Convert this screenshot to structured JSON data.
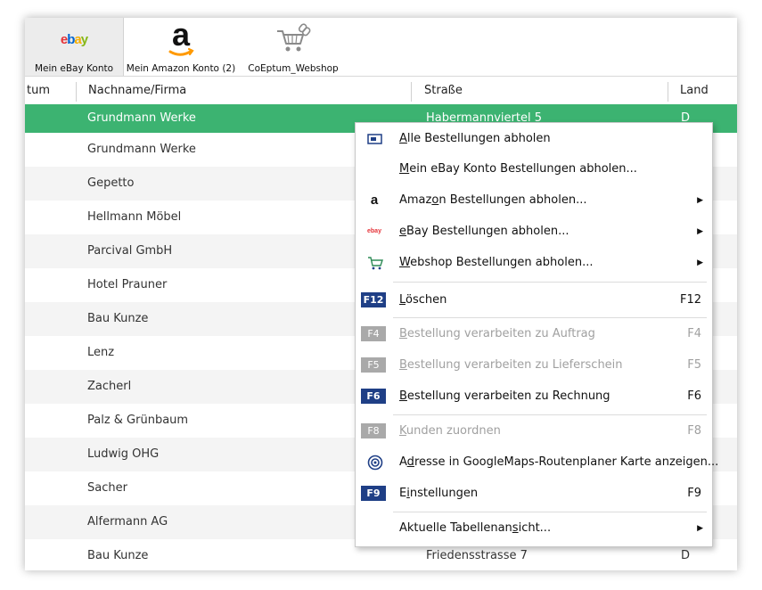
{
  "toolbar": {
    "buttons": [
      {
        "label": "Mein eBay Konto",
        "icon": "ebay-logo-icon"
      },
      {
        "label": "Mein Amazon Konto (2)",
        "icon": "amazon-logo-icon"
      },
      {
        "label": "CoEptum_Webshop",
        "icon": "webshop-cart-icon"
      }
    ]
  },
  "ebay_logo_text": [
    "e",
    "b",
    "a",
    "y"
  ],
  "amazon_logo_text": "a",
  "table": {
    "columns": [
      "tum",
      "Nachname/Firma",
      "Straße",
      "Land"
    ],
    "rows": [
      {
        "name": "Grundmann Werke",
        "street": "Habermannviertel 5",
        "country": "D"
      },
      {
        "name": "Grundmann Werke",
        "street": "",
        "country": ""
      },
      {
        "name": "Gepetto",
        "street": "",
        "country": ""
      },
      {
        "name": "Hellmann Möbel",
        "street": "",
        "country": ""
      },
      {
        "name": "Parcival GmbH",
        "street": "",
        "country": ""
      },
      {
        "name": "Hotel Prauner",
        "street": "",
        "country": ""
      },
      {
        "name": "Bau Kunze",
        "street": "",
        "country": ""
      },
      {
        "name": "Lenz",
        "street": "",
        "country": ""
      },
      {
        "name": "Zacherl",
        "street": "",
        "country": ""
      },
      {
        "name": "Palz & Grünbaum",
        "street": "",
        "country": ""
      },
      {
        "name": "Ludwig OHG",
        "street": "",
        "country": ""
      },
      {
        "name": "Sacher",
        "street": "",
        "country": ""
      },
      {
        "name": "Alfermann AG",
        "street": "",
        "country": ""
      },
      {
        "name": "Bau Kunze",
        "street": "Friedensstrasse 7",
        "country": "D"
      }
    ]
  },
  "menu": {
    "items": [
      {
        "u": "A",
        "rest": "lle Bestellungen abholen",
        "key": "",
        "icon": "monitor-icon"
      },
      {
        "u": "M",
        "rest": "ein eBay Konto Bestellungen abholen...",
        "key": ""
      },
      {
        "pre": "Amaz",
        "u": "o",
        "rest": "n Bestellungen abholen...",
        "icon": "amazon-icon",
        "icon_text": "a"
      },
      {
        "u": "e",
        "rest": "Bay Bestellungen abholen...",
        "icon": "ebay-icon",
        "icon_text": "ebay"
      },
      {
        "u": "W",
        "rest": "ebshop Bestellungen abholen...",
        "icon": "cart-icon"
      },
      {
        "u": "L",
        "rest": "öschen",
        "key": "F12",
        "fkey": "F12"
      },
      {
        "u": "B",
        "rest": "estellung verarbeiten zu Auftrag",
        "key": "F4",
        "fkey": "F4"
      },
      {
        "u": "B",
        "rest": "estellung verarbeiten zu Lieferschein",
        "key": "F5",
        "fkey": "F5"
      },
      {
        "u": "B",
        "rest": "estellung verarbeiten zu Rechnung",
        "key": "F6",
        "fkey": "F6"
      },
      {
        "u": "K",
        "rest": "unden zuordnen",
        "key": "F8",
        "fkey": "F8"
      },
      {
        "pre": "A",
        "u": "d",
        "rest": "resse in GoogleMaps-Routenplaner Karte anzeigen...",
        "icon": "target-icon"
      },
      {
        "pre": "E",
        "u": "i",
        "rest": "nstellungen",
        "key": "F9",
        "fkey": "F9"
      },
      {
        "pre": "Aktuelle Tabellenan",
        "u": "s",
        "rest": "icht..."
      }
    ]
  },
  "colors": {
    "selected_row": "#3cb371",
    "fkey_blue": "#1f3f86",
    "fkey_gray": "#a9a9a9"
  }
}
